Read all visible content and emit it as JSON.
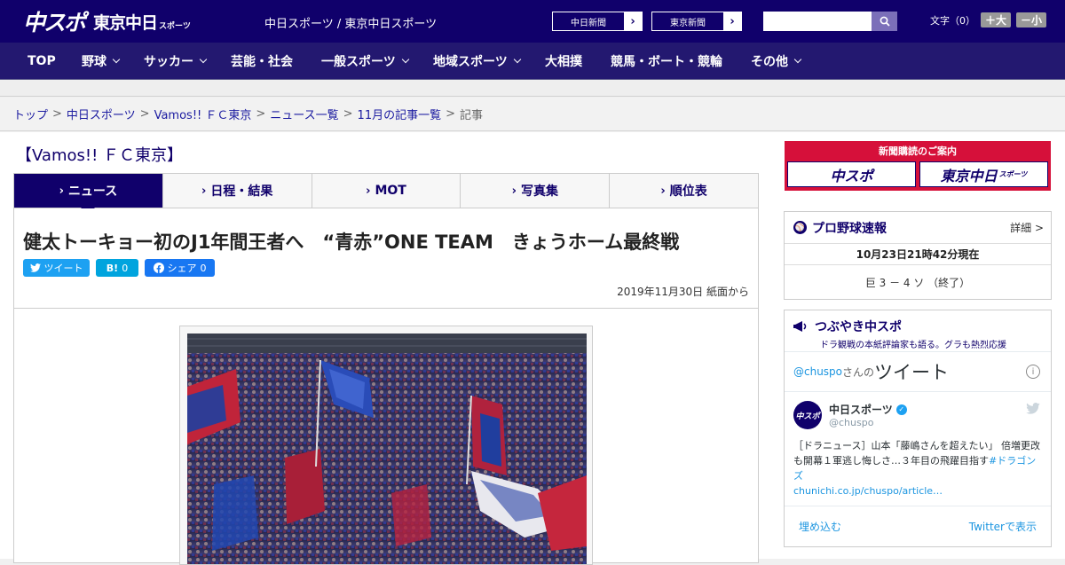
{
  "header": {
    "logo_main": "中スポ",
    "logo_tokyo": "東京中日",
    "logo_sports": "スポーツ",
    "site_name": "中日スポーツ / 東京中日スポーツ",
    "paper_buttons": [
      "中日新聞",
      "東京新聞"
    ],
    "font_size_label": "文字（0）",
    "font_plus": "＋大",
    "font_minus": "－小"
  },
  "nav": {
    "items": [
      {
        "label": "TOP",
        "has_dropdown": false
      },
      {
        "label": "野球",
        "has_dropdown": true
      },
      {
        "label": "サッカー",
        "has_dropdown": true
      },
      {
        "label": "芸能・社会",
        "has_dropdown": false
      },
      {
        "label": "一般スポーツ",
        "has_dropdown": true
      },
      {
        "label": "地域スポーツ",
        "has_dropdown": true
      },
      {
        "label": "大相撲",
        "has_dropdown": false
      },
      {
        "label": "競馬・ボート・競輪",
        "has_dropdown": false
      },
      {
        "label": "その他",
        "has_dropdown": true
      }
    ]
  },
  "breadcrumb": [
    "トップ",
    "中日スポーツ",
    "Vamos!! ＦＣ東京",
    "ニュース一覧",
    "11月の記事一覧",
    "記事"
  ],
  "category_title": "【Vamos!! ＦＣ東京】",
  "tabs": [
    {
      "label": "ニュース",
      "active": true
    },
    {
      "label": "日程・結果",
      "active": false
    },
    {
      "label": "MOT",
      "active": false
    },
    {
      "label": "写真集",
      "active": false
    },
    {
      "label": "順位表",
      "active": false
    }
  ],
  "article": {
    "headline": "健太トーキョー初のJ1年間王者へ　“青赤”ONE TEAM　きょうホーム最終戦",
    "share": {
      "tweet": "ツイート",
      "hatena": "B!",
      "hatena_count": "0",
      "facebook": "シェア",
      "facebook_count": "0"
    },
    "date": "2019年11月30日 紙面から"
  },
  "sidebar": {
    "ad_title": "新聞購読のご案内",
    "ad_left": "中スポ",
    "ad_right": "東京中日",
    "ad_right_sub": "スポーツ",
    "baseball": {
      "title": "プロ野球速報",
      "detail": "詳細 >",
      "time": "10月23日21時42分現在",
      "score": "巨 3 － 4 ソ （終了）"
    },
    "tweets": {
      "title": "つぶやき中スポ",
      "subtitle": "ドラ観戦の本紙評論家も語る。グラも熱烈応援",
      "handle": "@chuspo",
      "handle_suffix": "さんの",
      "tweets_label": "ツイート",
      "account_name": "中日スポーツ",
      "account_handle": "@chuspo",
      "text": "［ドラニュース］山本「藤嶋さんを超えたい」 倍増更改も開幕１軍逃し悔しさ…３年目の飛躍目指す",
      "hashtag": "#ドラゴンズ",
      "link": "chunichi.co.jp/chuspo/article…",
      "embed": "埋め込む",
      "view_on": "Twitterで表示"
    }
  }
}
